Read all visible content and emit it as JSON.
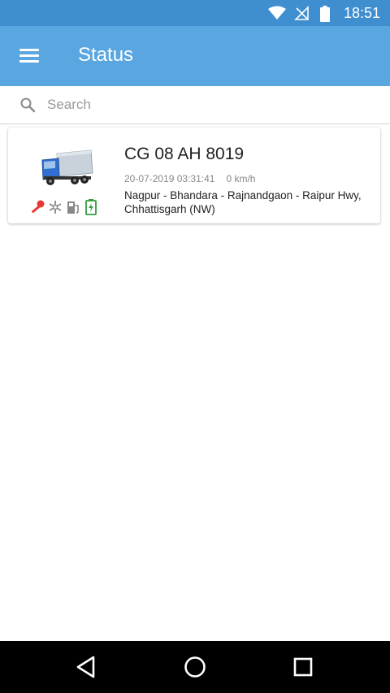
{
  "status_bar": {
    "time": "18:51",
    "icons": [
      "wifi-icon",
      "no-signal-icon",
      "battery-icon"
    ]
  },
  "app_bar": {
    "title": "Status",
    "menu_icon": "hamburger-menu-icon"
  },
  "search": {
    "placeholder": "Search",
    "value": ""
  },
  "vehicles": [
    {
      "name": "CG 08 AH 8019",
      "timestamp": "20-07-2019 03:31:41",
      "speed": "0 km/h",
      "address": "Nagpur - Bhandara - Rajnandgaon - Raipur Hwy, Chhattisgarh (NW)",
      "status_icons": [
        "ignition-key-icon",
        "ac-snowflake-icon",
        "fuel-pump-icon",
        "battery-charging-icon"
      ]
    }
  ],
  "colors": {
    "status_bar": "#3f8fd0",
    "app_bar": "#5aa6e0",
    "ignition": "#e53935",
    "ac": "#888888",
    "fuel": "#888888",
    "battery": "#2e9e3e",
    "truck_cab": "#2f6fd1"
  },
  "nav_bar": {
    "buttons": [
      "back-icon",
      "home-icon",
      "recents-icon"
    ]
  }
}
